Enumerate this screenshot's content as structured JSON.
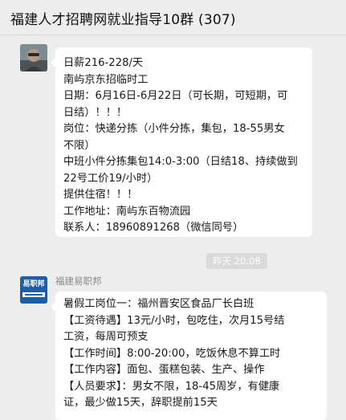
{
  "header": {
    "title": "福建人才招聘网就业指导10群 (307)"
  },
  "messages": [
    {
      "lines": [
        "日薪216-228/天",
        "南屿京东招临时工",
        "日期：6月16日-6月22日（可长期，可短期，可",
        "日结）！！！",
        "岗位：快递分拣（小件分拣，集包，18-55男女",
        "不限）",
        "中班小件分拣集包14:0-3:00（日结18、持续做到",
        "22号工价19/小时）",
        "提供住宿！！！",
        "工作地址：南屿东百物流园",
        "联系人：18960891268（微信同号）"
      ]
    },
    {
      "sender": "福建易职邦",
      "avatar_text": "易职邦",
      "lines": [
        "暑假工岗位一：福州晋安区食品厂长白班",
        "【工资待遇】13元/小时，包吃住，次月15号结",
        "工资，每周可预支",
        "【工作时间】8:00-20:00，吃饭休息不算工时",
        "【工作内容】面包、蛋糕包装、生产、操作",
        "【人员要求】：男女不限，18-45周岁，有健康",
        "证，最少做15天，辞职提前15天"
      ]
    }
  ],
  "timestamp": "昨天 20:08"
}
